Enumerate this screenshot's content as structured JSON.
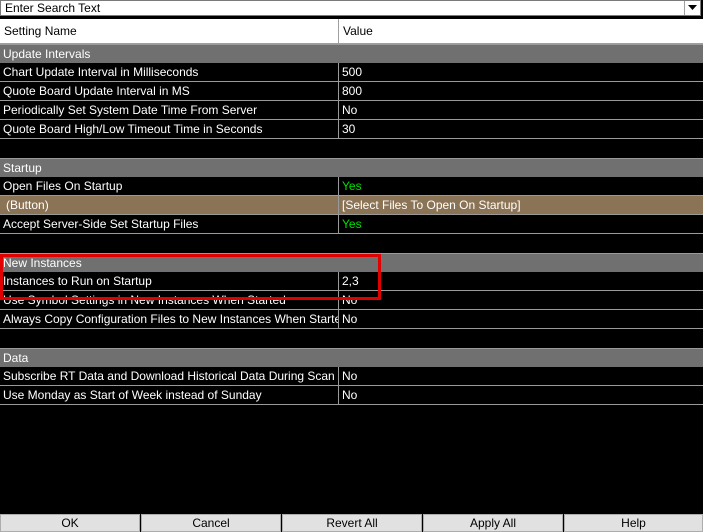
{
  "search": {
    "placeholder": "Enter Search Text",
    "dropdown_icon": "chevron-down-icon"
  },
  "columns": {
    "name": "Setting Name",
    "value": "Value"
  },
  "groups": [
    {
      "title": "Update Intervals",
      "rows": [
        {
          "name": "Chart Update Interval in Milliseconds",
          "value": "500"
        },
        {
          "name": "Quote Board Update Interval in MS",
          "value": "800"
        },
        {
          "name": "Periodically Set System Date Time From Server",
          "value": "No"
        },
        {
          "name": "Quote Board High/Low Timeout Time in Seconds",
          "value": "30"
        }
      ]
    },
    {
      "title": "Startup",
      "rows": [
        {
          "name": "Open Files On Startup",
          "value": "Yes"
        },
        {
          "name": "(Button)",
          "value": "[Select Files To Open On Startup]"
        },
        {
          "name": "Accept Server-Side Set Startup Files",
          "value": "Yes"
        }
      ]
    },
    {
      "title": "New Instances",
      "rows": [
        {
          "name": "Instances to Run on Startup",
          "value": "2,3"
        },
        {
          "name": "Use Symbol Settings in New Instances When Started",
          "value": "No"
        },
        {
          "name": "Always Copy Configuration Files to New Instances When Started",
          "value": "No"
        }
      ]
    },
    {
      "title": "Data",
      "rows": [
        {
          "name": "Subscribe RT Data and Download Historical Data During Scan",
          "value": "No"
        },
        {
          "name": "Use Monday as Start of Week instead of Sunday",
          "value": "No"
        }
      ]
    }
  ],
  "footer": {
    "ok": "OK",
    "cancel": "Cancel",
    "revert_all": "Revert All",
    "apply_all": "Apply All",
    "help": "Help"
  },
  "colors": {
    "background": "#000000",
    "group_header": "#707070",
    "button_row": "#8b7355",
    "yes_value": "#00e000",
    "highlight": "#e00000"
  }
}
